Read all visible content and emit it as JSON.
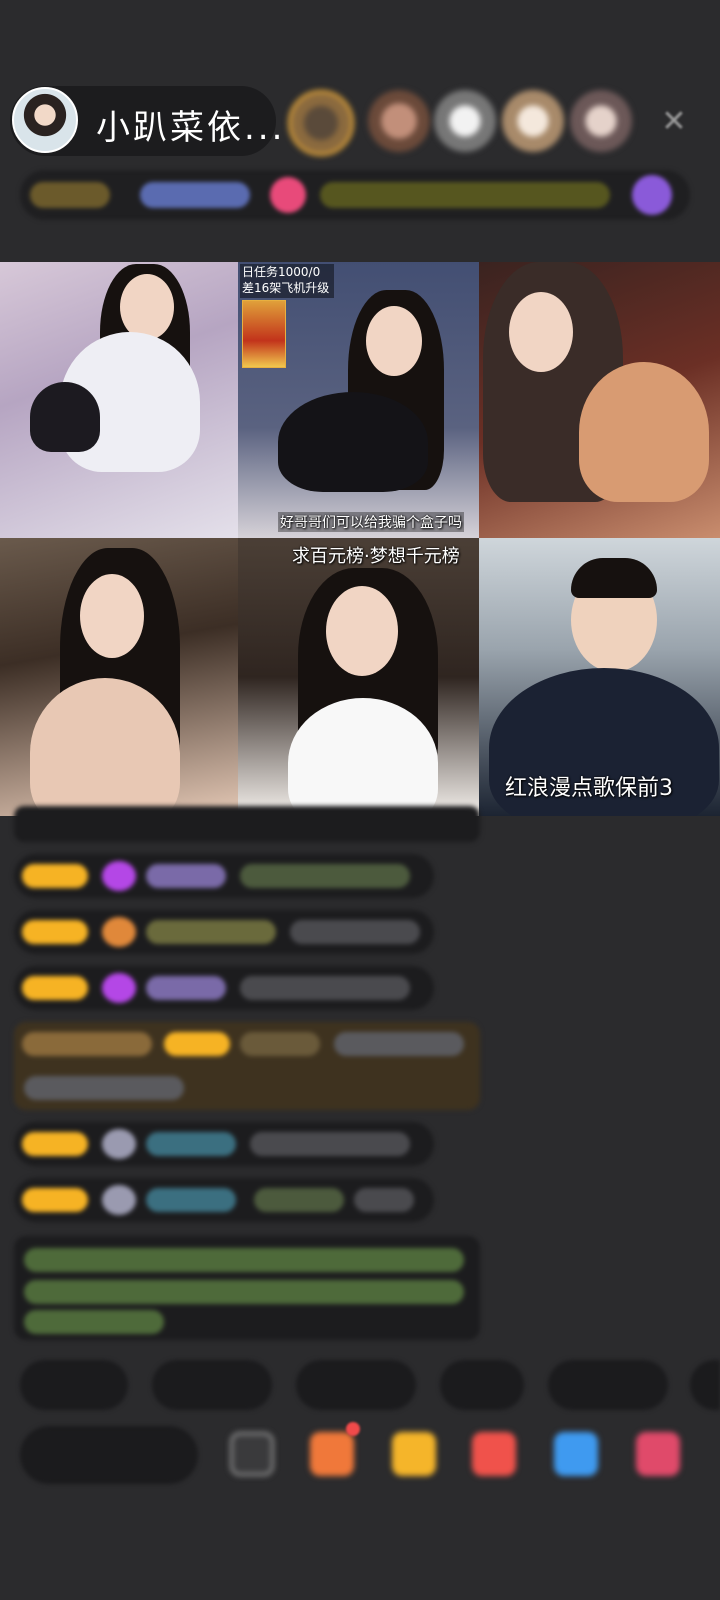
{
  "header": {
    "host_name": "小趴菜依...",
    "close_icon": "close-icon"
  },
  "videos": [
    {
      "id": "stream-1",
      "overlay": ""
    },
    {
      "id": "stream-2",
      "task_line1": "日任务1000/0",
      "task_line2": "差16架飞机升级",
      "caption": "好哥哥们可以给我骗个盒子吗"
    },
    {
      "id": "stream-3",
      "overlay": ""
    },
    {
      "id": "stream-4",
      "overlay": ""
    },
    {
      "id": "stream-5",
      "top_caption": "求百元榜·梦想千元榜"
    },
    {
      "id": "stream-6",
      "caption": "红浪漫点歌保前3"
    }
  ],
  "colors": {
    "background": "#2b2b2d",
    "badge_gold": "#f6b324",
    "badge_purple": "#b447e6",
    "chat_green": "#a6e07a",
    "chat_blue": "#7ac8e6",
    "gift_red": "#f0524b",
    "gift_blue": "#3f9af0"
  },
  "icons": [
    "gift-icon",
    "red-packet-icon",
    "heart-icon",
    "game-icon",
    "more-icon"
  ]
}
